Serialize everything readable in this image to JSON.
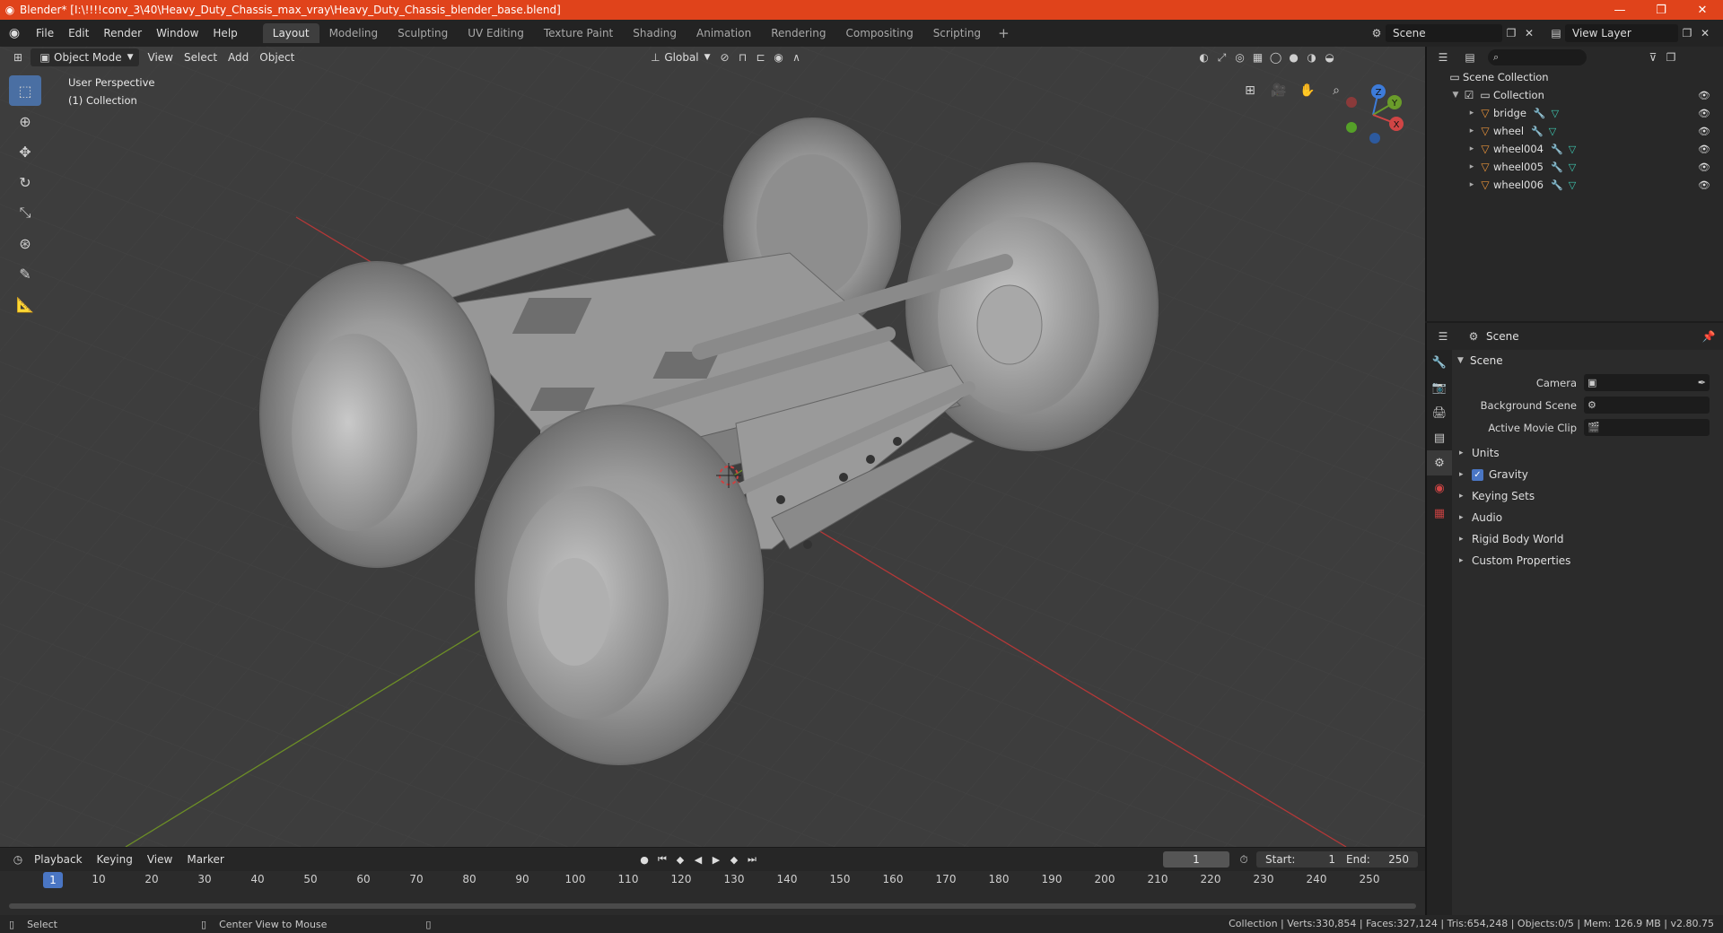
{
  "window": {
    "title": "Blender* [I:\\!!!!conv_3\\40\\Heavy_Duty_Chassis_max_vray\\Heavy_Duty_Chassis_blender_base.blend]",
    "controls": [
      "—",
      "❐",
      "✕"
    ]
  },
  "menu": {
    "items": [
      "File",
      "Edit",
      "Render",
      "Window",
      "Help"
    ],
    "workspaces": [
      "Layout",
      "Modeling",
      "Sculpting",
      "UV Editing",
      "Texture Paint",
      "Shading",
      "Animation",
      "Rendering",
      "Compositing",
      "Scripting"
    ],
    "active_workspace": "Layout",
    "scene": "Scene",
    "view_layer": "View Layer"
  },
  "viewport": {
    "mode": "Object Mode",
    "menus": [
      "View",
      "Select",
      "Add",
      "Object"
    ],
    "orientation": "Global",
    "perspective_label": "User Perspective",
    "collection_label": "(1) Collection",
    "gizmo_axes": [
      "Z",
      "Y",
      "X"
    ],
    "colors": {
      "background": "#3d3d3d",
      "x_axis": "#b53838",
      "y_axis": "#6d8f26",
      "model": "#8f8f8f"
    }
  },
  "toolbar": {
    "tools": [
      "select-box-icon",
      "cursor-icon",
      "move-icon",
      "rotate-icon",
      "scale-icon",
      "transform-icon",
      "annotate-icon",
      "measure-icon"
    ]
  },
  "timeline": {
    "menus": [
      "Playback",
      "Keying",
      "View",
      "Marker"
    ],
    "current_frame": "1",
    "start_label": "Start:",
    "start": "1",
    "end_label": "End:",
    "end": "250",
    "ticks": [
      "10",
      "20",
      "30",
      "40",
      "50",
      "60",
      "70",
      "80",
      "90",
      "100",
      "110",
      "120",
      "130",
      "140",
      "150",
      "160",
      "170",
      "180",
      "190",
      "200",
      "210",
      "220",
      "230",
      "240",
      "250"
    ]
  },
  "status": {
    "left_action": "Select",
    "mid_action": "Center View to Mouse",
    "stats": "Collection | Verts:330,854 | Faces:327,124 | Tris:654,248 | Objects:0/5 | Mem: 126.9 MB | v2.80.75"
  },
  "outliner": {
    "root": "Scene Collection",
    "collection": "Collection",
    "objects": [
      "bridge",
      "wheel",
      "wheel004",
      "wheel005",
      "wheel006"
    ]
  },
  "properties": {
    "context": "Scene",
    "panel": "Scene",
    "rows": [
      {
        "label": "Camera",
        "value": ""
      },
      {
        "label": "Background Scene",
        "value": ""
      },
      {
        "label": "Active Movie Clip",
        "value": ""
      }
    ],
    "sections": [
      "Units",
      "Gravity",
      "Keying Sets",
      "Audio",
      "Rigid Body World",
      "Custom Properties"
    ],
    "gravity_checked": true
  }
}
